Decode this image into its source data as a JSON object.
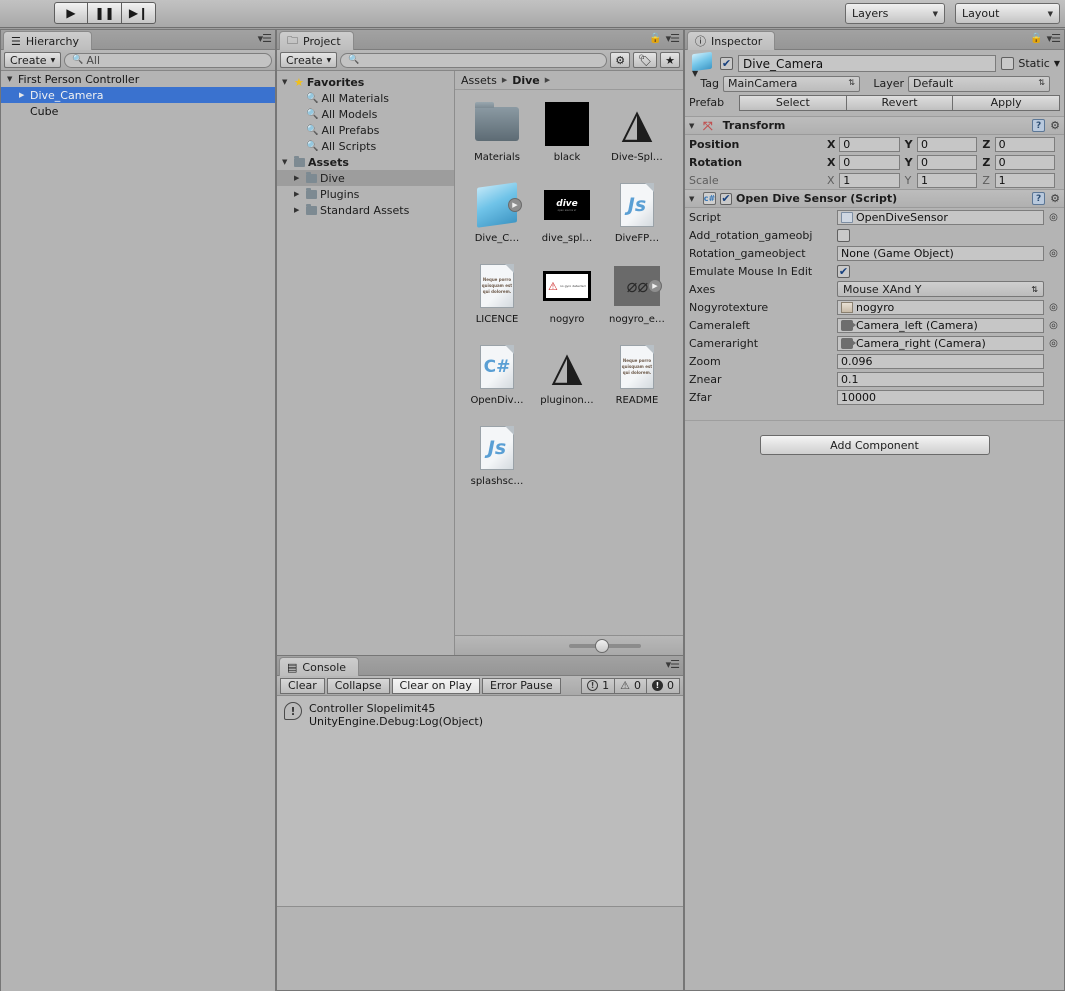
{
  "toolbar": {
    "play": "▶",
    "pause": "❚❚",
    "step": "▶❙",
    "layers_label": "Layers",
    "layout_label": "Layout"
  },
  "hierarchy": {
    "tab_label": "Hierarchy",
    "create_label": "Create",
    "search_placeholder": "All",
    "items": [
      {
        "label": "First Person Controller",
        "indent": 0,
        "expanded": true,
        "selected": false
      },
      {
        "label": "Dive_Camera",
        "indent": 1,
        "expanded": false,
        "selected": true
      },
      {
        "label": "Cube",
        "indent": 1,
        "expanded": null,
        "selected": false
      }
    ]
  },
  "project": {
    "tab_label": "Project",
    "create_label": "Create",
    "search_placeholder": "",
    "tree": [
      {
        "label": "Favorites",
        "type": "star",
        "indent": 0,
        "bold": true,
        "expanded": true
      },
      {
        "label": "All Materials",
        "type": "search",
        "indent": 1
      },
      {
        "label": "All Models",
        "type": "search",
        "indent": 1
      },
      {
        "label": "All Prefabs",
        "type": "search",
        "indent": 1
      },
      {
        "label": "All Scripts",
        "type": "search",
        "indent": 1
      },
      {
        "label": "Assets",
        "type": "folder",
        "indent": 0,
        "bold": true,
        "expanded": true
      },
      {
        "label": "Dive",
        "type": "folder",
        "indent": 1,
        "selected": true
      },
      {
        "label": "Plugins",
        "type": "folder",
        "indent": 1
      },
      {
        "label": "Standard Assets",
        "type": "folder",
        "indent": 1
      }
    ],
    "breadcrumb": [
      "Assets",
      "Dive"
    ],
    "assets": [
      {
        "label": "Materials",
        "kind": "folder"
      },
      {
        "label": "black",
        "kind": "black-square"
      },
      {
        "label": "Dive-Spl…",
        "kind": "unity"
      },
      {
        "label": "Dive_C…",
        "kind": "prefab-cube",
        "badge": true
      },
      {
        "label": "dive_spl…",
        "kind": "dive-splash",
        "splash_text": "dive",
        "splash_sub": "open source vr"
      },
      {
        "label": "DiveFP…",
        "kind": "js"
      },
      {
        "label": "LICENCE",
        "kind": "textdoc",
        "doc_text": "Neque porro quisquam est qui dolorem."
      },
      {
        "label": "nogyro",
        "kind": "nogyro"
      },
      {
        "label": "nogyro_e…",
        "kind": "nogyro-e",
        "badge": true
      },
      {
        "label": "OpenDiv…",
        "kind": "csharp"
      },
      {
        "label": "pluginon…",
        "kind": "unity"
      },
      {
        "label": "README",
        "kind": "textdoc",
        "doc_text": "Neque porro quisquam est qui dolorem."
      },
      {
        "label": "splashsc…",
        "kind": "js"
      }
    ]
  },
  "console": {
    "tab_label": "Console",
    "buttons": [
      {
        "label": "Clear",
        "active": false
      },
      {
        "label": "Collapse",
        "active": false
      },
      {
        "label": "Clear on Play",
        "active": true
      },
      {
        "label": "Error Pause",
        "active": false
      }
    ],
    "counts": [
      {
        "icon": "info",
        "value": "1"
      },
      {
        "icon": "warning",
        "value": "0"
      },
      {
        "icon": "error",
        "value": "0"
      }
    ],
    "log": {
      "line1": "Controller Slopelimit45",
      "line2": "UnityEngine.Debug:Log(Object)"
    }
  },
  "inspector": {
    "tab_label": "Inspector",
    "object_name": "Dive_Camera",
    "object_enabled": true,
    "static_label": "Static",
    "static_checked": false,
    "tag_label": "Tag",
    "tag_value": "MainCamera",
    "layer_label": "Layer",
    "layer_value": "Default",
    "prefab_label": "Prefab",
    "prefab_buttons": [
      "Select",
      "Revert",
      "Apply"
    ],
    "transform": {
      "title": "Transform",
      "position_label": "Position",
      "position": {
        "x": "0",
        "y": "0",
        "z": "0"
      },
      "rotation_label": "Rotation",
      "rotation": {
        "x": "0",
        "y": "0",
        "z": "0"
      },
      "scale_label": "Scale",
      "scale": {
        "x": "1",
        "y": "1",
        "z": "1"
      },
      "axis_x": "X",
      "axis_y": "Y",
      "axis_z": "Z"
    },
    "script_component": {
      "title": "Open Dive Sensor (Script)",
      "enabled": true,
      "fields": [
        {
          "label": "Script",
          "value": "OpenDiveSensor",
          "type": "object",
          "icon": "script-icon"
        },
        {
          "label": "Add_rotation_gameobj",
          "value": "",
          "type": "checkbox",
          "checked": false
        },
        {
          "label": "Rotation_gameobject",
          "value": "None (Game Object)",
          "type": "object",
          "icon": "none-icon"
        },
        {
          "label": "Emulate Mouse In Edit",
          "value": "",
          "type": "checkbox",
          "checked": true
        },
        {
          "label": "Axes",
          "value": "Mouse XAnd Y",
          "type": "popup"
        },
        {
          "label": "Nogyrotexture",
          "value": "nogyro",
          "type": "object",
          "icon": "texture-icon"
        },
        {
          "label": "Cameraleft",
          "value": "Camera_left (Camera)",
          "type": "object",
          "icon": "camera-icon"
        },
        {
          "label": "Cameraright",
          "value": "Camera_right (Camera)",
          "type": "object",
          "icon": "camera-icon"
        },
        {
          "label": "Zoom",
          "value": "0.096",
          "type": "text"
        },
        {
          "label": "Znear",
          "value": "0.1",
          "type": "text"
        },
        {
          "label": "Zfar",
          "value": "10000",
          "type": "text"
        }
      ]
    },
    "add_component_label": "Add Component"
  },
  "colors": {
    "selection_blue": "#3a72cf",
    "panel_bg": "#b4b4b4",
    "chrome": "#9e9e9e"
  }
}
